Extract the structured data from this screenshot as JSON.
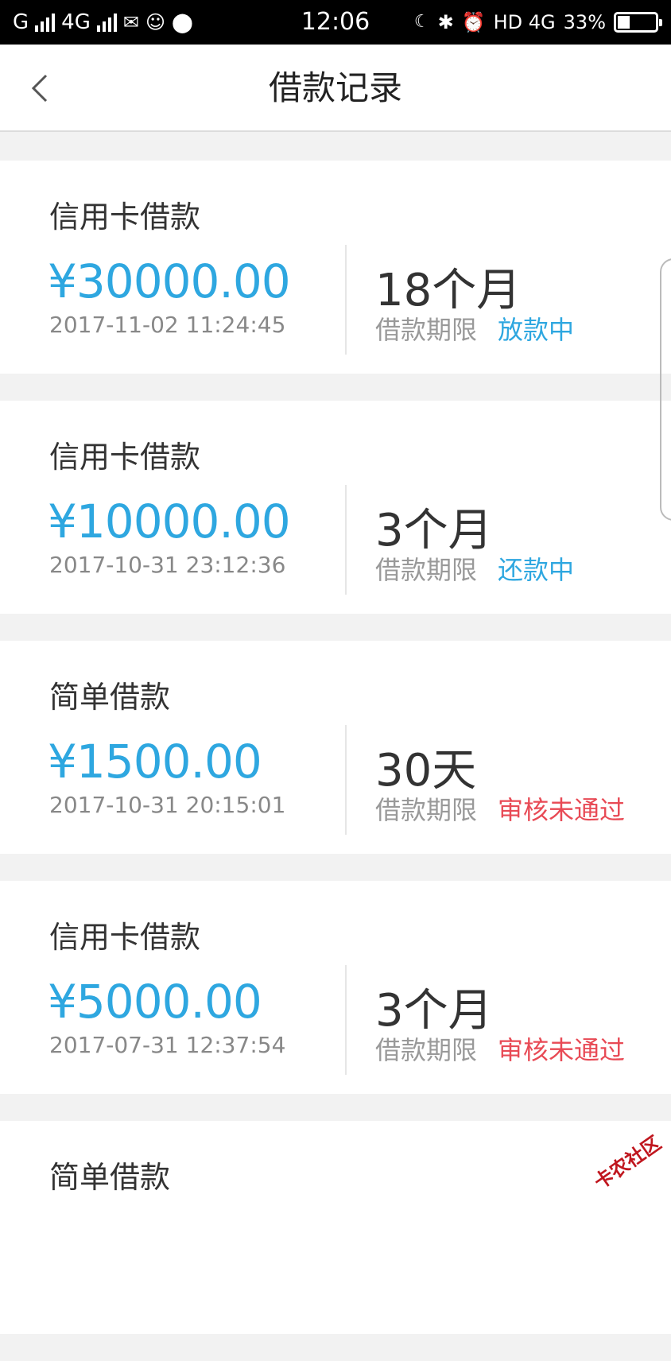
{
  "statusbar": {
    "carrier1": "G",
    "carrier2": "4G",
    "time": "12:06",
    "network": "HD 4G",
    "battery": "33%",
    "battery_level": 0.33
  },
  "nav": {
    "title": "借款记录"
  },
  "records": [
    {
      "type": "信用卡借款",
      "amount": "¥30000.00",
      "date": "2017-11-02 11:24:45",
      "term": "18个月",
      "term_label": "借款期限",
      "status": "放款中",
      "status_color": "#2ea7e0"
    },
    {
      "type": "信用卡借款",
      "amount": "¥10000.00",
      "date": "2017-10-31 23:12:36",
      "term": "3个月",
      "term_label": "借款期限",
      "status": "还款中",
      "status_color": "#2ea7e0"
    },
    {
      "type": "简单借款",
      "amount": "¥1500.00",
      "date": "2017-10-31 20:15:01",
      "term": "30天",
      "term_label": "借款期限",
      "status": "审核未通过",
      "status_color": "#e84a55"
    },
    {
      "type": "信用卡借款",
      "amount": "¥5000.00",
      "date": "2017-07-31 12:37:54",
      "term": "3个月",
      "term_label": "借款期限",
      "status": "审核未通过",
      "status_color": "#e84a55"
    },
    {
      "type": "简单借款"
    }
  ],
  "watermark": "卡农社区",
  "colors": {
    "accent": "#2ea7e0",
    "rejected": "#e84a55"
  }
}
